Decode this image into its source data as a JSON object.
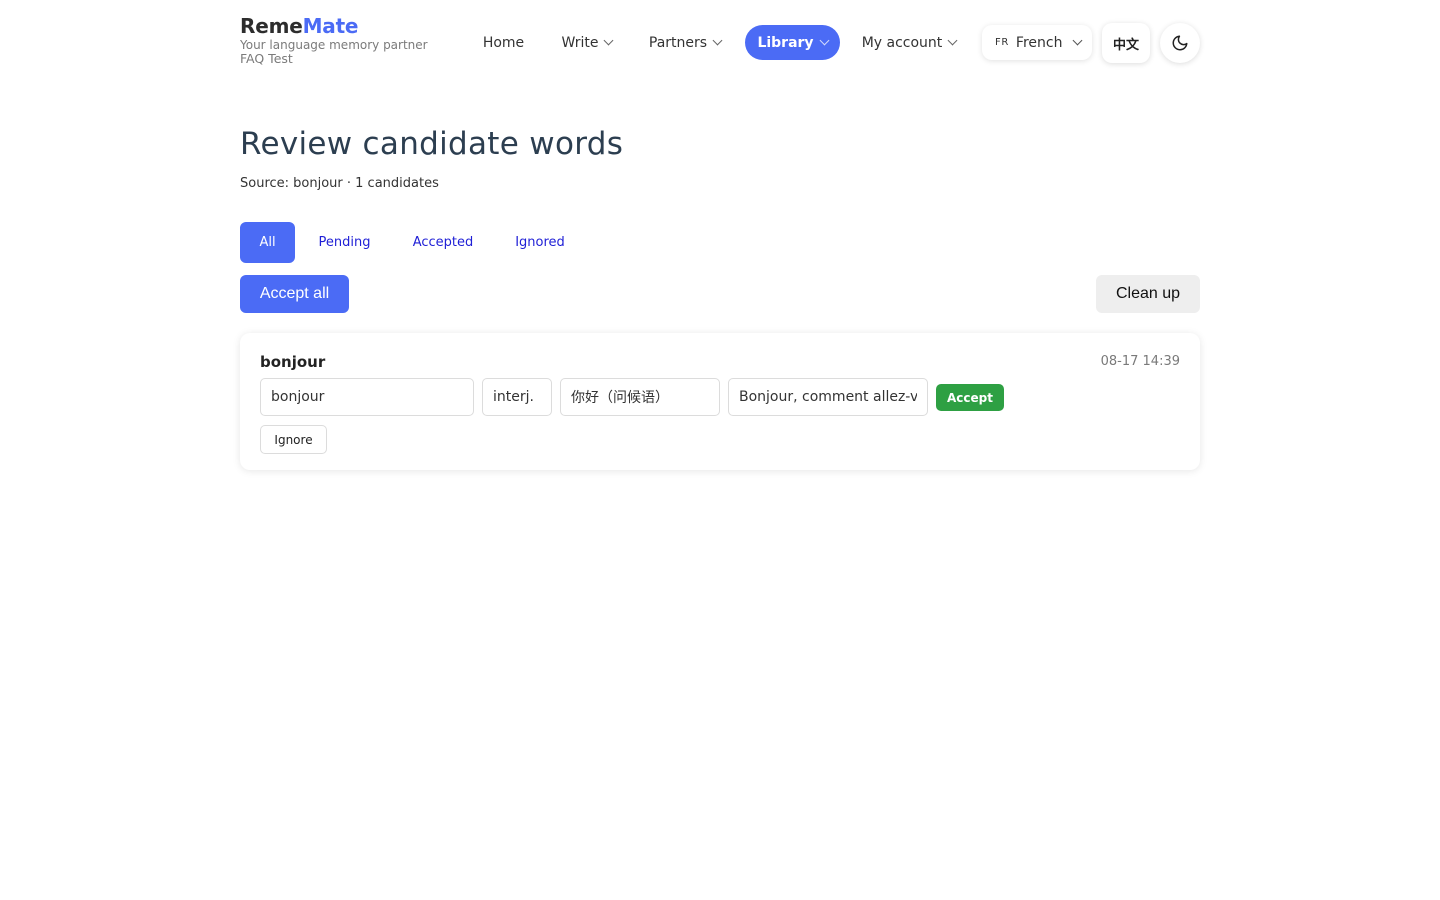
{
  "brand": {
    "name_prefix": "Reme",
    "name_accent": "Mate",
    "tagline": "Your language memory partner",
    "sub": "FAQ Test"
  },
  "nav": {
    "home": "Home",
    "write": "Write",
    "partners": "Partners",
    "library": "Library",
    "account": "My account"
  },
  "language": {
    "code": "FR",
    "label": "French"
  },
  "ui_language_button": "中文",
  "theme_icon": "moon-icon",
  "page": {
    "title": "Review candidate words",
    "subtitle": "Source: bonjour · 1 candidates"
  },
  "tabs": {
    "all": "All",
    "pending": "Pending",
    "accepted": "Accepted",
    "ignored": "Ignored",
    "active": "All"
  },
  "actions": {
    "accept_all": "Accept all",
    "clean_up": "Clean up"
  },
  "candidate": {
    "word": "bonjour",
    "time": "08-17 14:39",
    "fields": {
      "term": "bonjour",
      "pos": "interj.",
      "translation": "你好（问候语）",
      "example": "Bonjour, comment allez-vous ?"
    },
    "accept_label": "Accept",
    "ignore_label": "Ignore"
  },
  "colors": {
    "accent": "#4b6bf5",
    "success": "#2ea043",
    "link": "#1f1fd6"
  }
}
